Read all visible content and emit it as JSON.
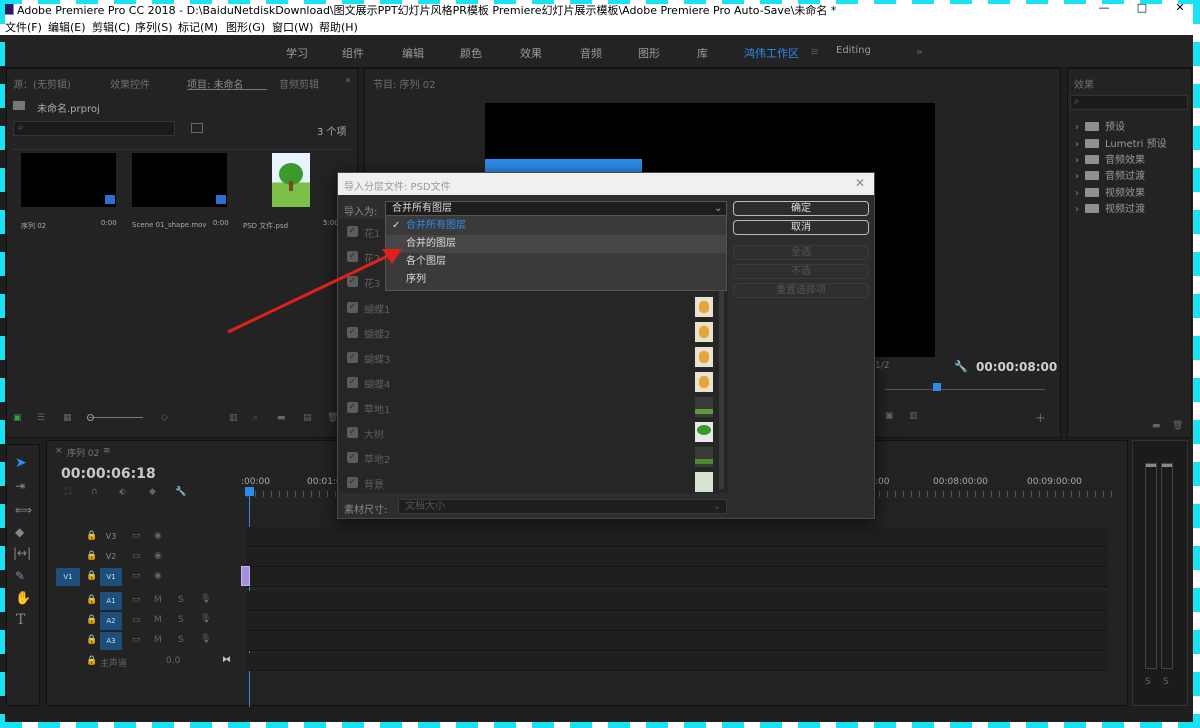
{
  "window": {
    "title": "Adobe Premiere Pro CC 2018 - D:\\BaiduNetdiskDownload\\图文展示PPT幻灯片风格PR模板 Premiere幻灯片展示模板\\Adobe Premiere Pro Auto-Save\\未命名 *",
    "minimize": "—",
    "maximize": "□",
    "close": "✕"
  },
  "menu": [
    "文件(F)",
    "编辑(E)",
    "剪辑(C)",
    "序列(S)",
    "标记(M)",
    "图形(G)",
    "窗口(W)",
    "帮助(H)"
  ],
  "workspaces": {
    "tabs": [
      "学习",
      "组件",
      "编辑",
      "颜色",
      "效果",
      "音频",
      "图形",
      "库",
      "鸿伟工作区",
      "Editing"
    ],
    "active": "鸿伟工作区",
    "overflow": "»"
  },
  "project_panel": {
    "tabs": [
      "源：(无剪辑)",
      "效果控件",
      "项目: 未命名",
      "音频剪辑",
      "»"
    ],
    "project_name": "未命名.prproj",
    "item_count": "3 个项",
    "items": [
      {
        "name": "序列 02",
        "duration": "0:00"
      },
      {
        "name": "Scene 01_shape.mov",
        "duration": "0:00"
      },
      {
        "name": "PSD 文件.psd",
        "duration": "5:00"
      }
    ]
  },
  "program_monitor": {
    "tab": "节目: 序列 02",
    "timecode": "00:00:08:00",
    "fit": "1/2"
  },
  "dialog": {
    "title": "导入分层文件: PSD文件",
    "close": "✕",
    "import_as_label": "导入为:",
    "import_as_value": "合并所有图层",
    "dropdown_options": [
      "合并所有图层",
      "合并的图层",
      "各个图层",
      "序列"
    ],
    "checkmark": "✓",
    "ok_button": "确定",
    "cancel_button": "取消",
    "select_all_button": "全选",
    "select_none_button": "不选",
    "reset_button": "重置选择项",
    "layers_hidden": [
      "花1",
      "花2",
      "花3"
    ],
    "layers": [
      "蝴蝶1",
      "蝴蝶2",
      "蝴蝶3",
      "蝴蝶4",
      "草地1",
      "大树",
      "草地2",
      "背景"
    ],
    "footage_size_label": "素材尺寸:",
    "footage_size_value": "文档大小"
  },
  "timeline": {
    "tab": "序列 02",
    "timecode": "00:00:06:18",
    "ruler": [
      ":00:00",
      "00:01:0",
      ":00",
      "00:08:00:00",
      "00:09:00:00"
    ],
    "video_tracks": [
      "V3",
      "V2",
      "V1"
    ],
    "audio_tracks": [
      "A1",
      "A2",
      "A3"
    ],
    "source_v": "V1",
    "master_label": "主声道",
    "master_value": "0.0",
    "mute": "M",
    "solo": "S"
  },
  "effects_panel": {
    "tab": "效果",
    "items": [
      "预设",
      "Lumetri 预设",
      "音频效果",
      "音频过渡",
      "视频效果",
      "视频过渡"
    ]
  },
  "colors": {
    "accent_blue": "#2d8ceb",
    "arrow_red": "#e0201c",
    "frame_cyan": "#19e3f0",
    "clip_purple": "#a48ddb"
  },
  "icons": [
    "search-icon",
    "folder-icon",
    "lock-icon",
    "eye-icon",
    "wrench-icon",
    "selection-tool-icon",
    "razor-tool-icon",
    "pen-tool-icon",
    "hand-tool-icon",
    "type-tool-icon",
    "checkbox-icon",
    "red-arrow-icon"
  ]
}
